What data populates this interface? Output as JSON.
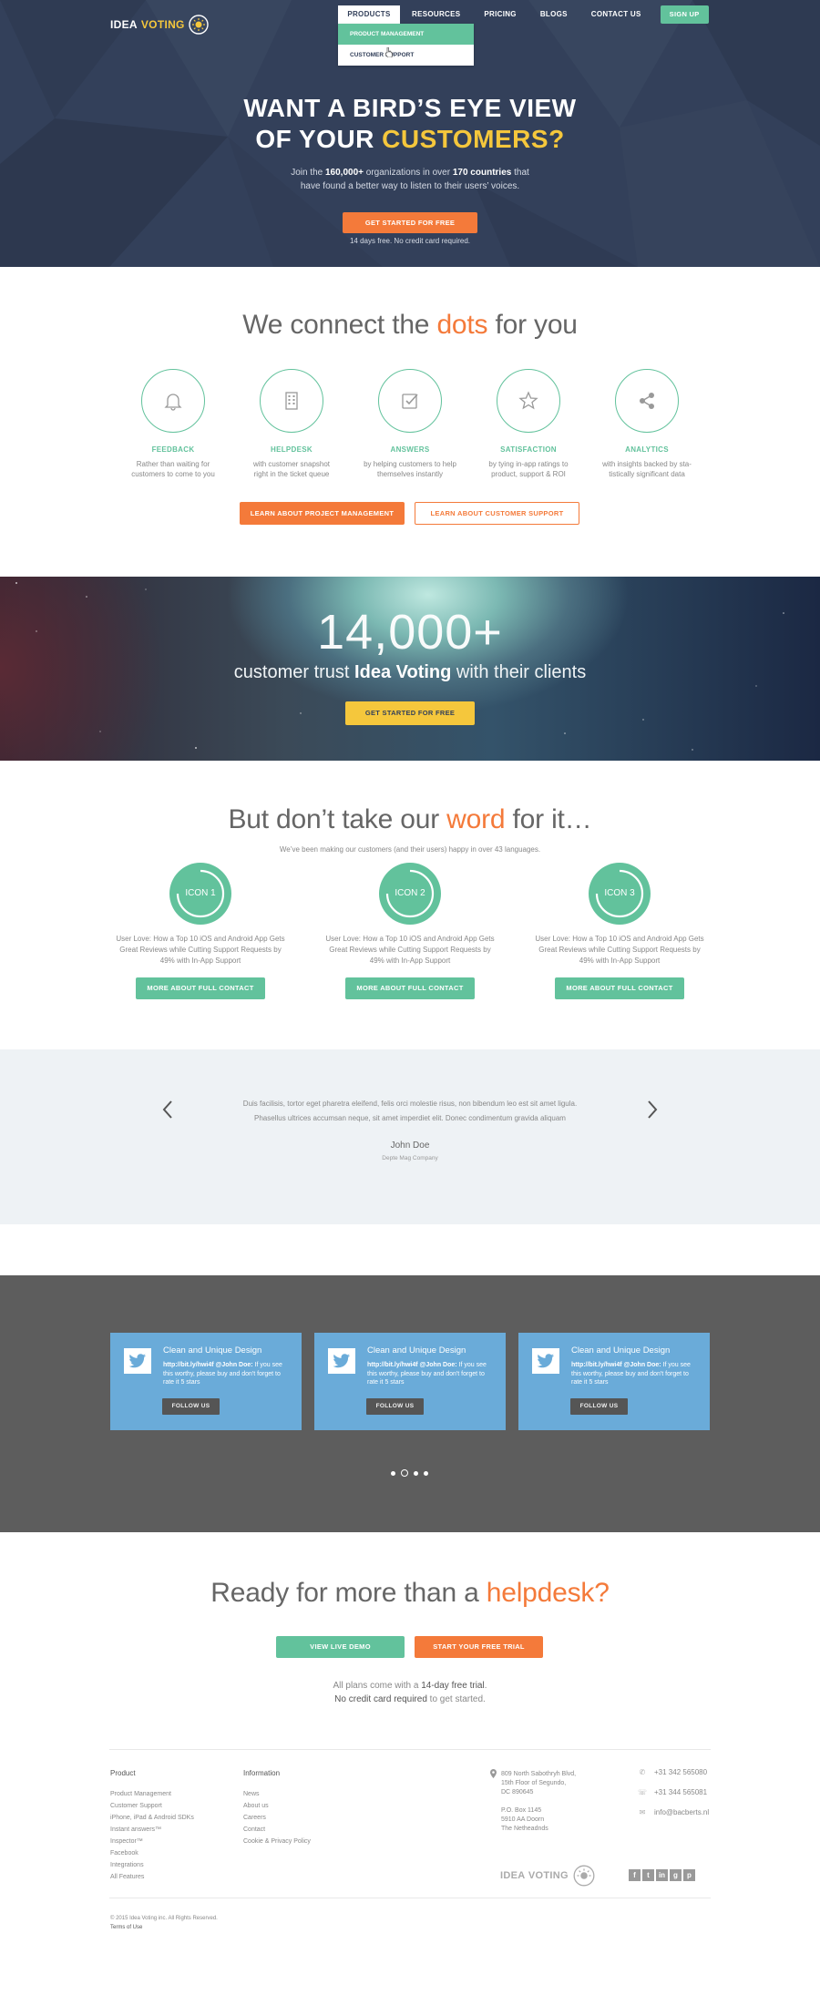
{
  "brand": {
    "name_left": "IDEA",
    "name_right": "VOTING",
    "accent": "#f47a3a",
    "green": "#62c29c",
    "yellow": "#f5c73c",
    "navy": "#33405a"
  },
  "nav": {
    "items": [
      "PRODUCTS",
      "RESOURCES",
      "PRICING",
      "BLOGS",
      "CONTACT US"
    ],
    "signup": "SIGN UP",
    "dropdown": [
      "PRODUCT MANAGEMENT",
      "CUSTOMER SUPPORT"
    ]
  },
  "hero": {
    "title_line1": "WANT A BIRD’S EYE VIEW",
    "title_line2_a": "OF YOUR ",
    "title_line2_b": "CUSTOMERS?",
    "sub_a": "Join the ",
    "sub_count": "160,000+",
    "sub_b": " organizations in over ",
    "sub_countries": "170 countries",
    "sub_c": " that",
    "sub_line2": "have found a better way to listen to their users’ voices.",
    "cta": "GET STARTED FOR FREE",
    "note": "14 days free. No credit card required."
  },
  "connect": {
    "title_a": "We connect the ",
    "title_b": "dots",
    "title_c": " for you",
    "features": [
      {
        "icon": "bell-icon",
        "title": "FEEDBACK",
        "desc1": "Rather than waiting for",
        "desc2": "customers to come to you"
      },
      {
        "icon": "building-icon",
        "title": "HELPDESK",
        "desc1": "with customer snapshot",
        "desc2": "right in the ticket queue"
      },
      {
        "icon": "checkbox-icon",
        "title": "ANSWERS",
        "desc1": "by helping customers to help",
        "desc2": "themselves instantly"
      },
      {
        "icon": "star-icon",
        "title": "SATISFACTION",
        "desc1": "by tying in-app ratings to",
        "desc2": "product, support & ROI"
      },
      {
        "icon": "share-icon",
        "title": "ANALYTICS",
        "desc1": "with insights backed by sta-",
        "desc2": "tistically significant data"
      }
    ],
    "btn1": "LEARN ABOUT PROJECT MANAGEMENT",
    "btn2": "LEARN ABOUT CUSTOMER SUPPORT"
  },
  "stats": {
    "number": "14,000+",
    "text_a": "customer trust ",
    "text_b": "Idea Voting",
    "text_c": " with their clients",
    "cta": "GET STARTED FOR FREE"
  },
  "word": {
    "title_a": "But don’t take our ",
    "title_b": "word",
    "title_c": " for it…",
    "sub": "We’ve been making our customers (and their users) happy in over 43 languages.",
    "cols": [
      {
        "icon": "ICON 1",
        "l1": "User Love: How a Top 10 iOS and Android App Gets",
        "l2": "Great Reviews while Cutting Support Requests by",
        "l3": "49% with In-App Support",
        "btn": "MORE ABOUT FULL CONTACT"
      },
      {
        "icon": "ICON 2",
        "l1": "User Love: How a Top 10 iOS and Android App Gets",
        "l2": "Great Reviews while Cutting Support Requests by",
        "l3": "49% with In-App Support",
        "btn": "MORE ABOUT FULL CONTACT"
      },
      {
        "icon": "ICON 3",
        "l1": "User Love: How a Top 10 iOS and Android App Gets",
        "l2": "Great Reviews while Cutting Support Requests by",
        "l3": "49% with In-App Support",
        "btn": "MORE ABOUT FULL CONTACT"
      }
    ]
  },
  "testimonial": {
    "line1": "Duis facilisis, tortor eget pharetra eleifend, felis orci molestie risus, non bibendum leo est sit amet ligula.",
    "line2": "Phasellus ultrices accumsan neque, sit amet imperdiet elit. Donec condimentum gravida aliquam",
    "name": "John Doe",
    "company": "Depte Mag Company"
  },
  "tweets": [
    {
      "title": "Clean and Unique Design",
      "link": "http://bit.ly/hwi4f @John Doe:",
      "body": " If you see this worthy, please buy and don't forget to rate it 5 stars",
      "btn": "FOLLOW US"
    },
    {
      "title": "Clean and Unique Design",
      "link": "http://bit.ly/hwi4f @John Doe:",
      "body": " If you see this worthy, please buy and don't forget to rate it 5 stars",
      "btn": "FOLLOW US"
    },
    {
      "title": "Clean and Unique Design",
      "link": "http://bit.ly/hwi4f @John Doe:",
      "body": " If you see this worthy, please buy and don't forget to rate it 5 stars",
      "btn": "FOLLOW US"
    }
  ],
  "ready": {
    "title_a": "Ready for more than a ",
    "title_b": "helpdesk?",
    "btn1": "VIEW LIVE DEMO",
    "btn2": "START YOUR FREE TRIAL",
    "note1_a": "All plans come with a ",
    "note1_b": "14-day free trial",
    "note1_c": ".",
    "note2_a": "No credit card required",
    "note2_b": " to get started."
  },
  "footer": {
    "product": {
      "heading": "Product",
      "links": [
        "Product Management",
        "Customer Support",
        "iPhone, iPad & Android SDKs",
        "Instant answers™",
        "Inspector™",
        "Facebook",
        "Integrations",
        "All Features"
      ]
    },
    "info": {
      "heading": "Information",
      "links": [
        "News",
        "About us",
        "Careers",
        "Contact",
        "Cookie & Privacy Policy"
      ]
    },
    "address": [
      "809 North Sabothryh Blvd,",
      "15th Floor of Segundo,",
      "DC 890645",
      "",
      "P.O. Box 1145",
      "5910 AA Doorn",
      "The Netheadnds"
    ],
    "phone1": "+31 342 565080",
    "phone2": "+31 344 565081",
    "email": "info@bacberts.nl",
    "social": [
      "f",
      "t",
      "in",
      "g",
      "p"
    ],
    "copyright": "© 2015 Idea Voting inc. All Rights Reserved.",
    "terms": "Terms of Use"
  }
}
